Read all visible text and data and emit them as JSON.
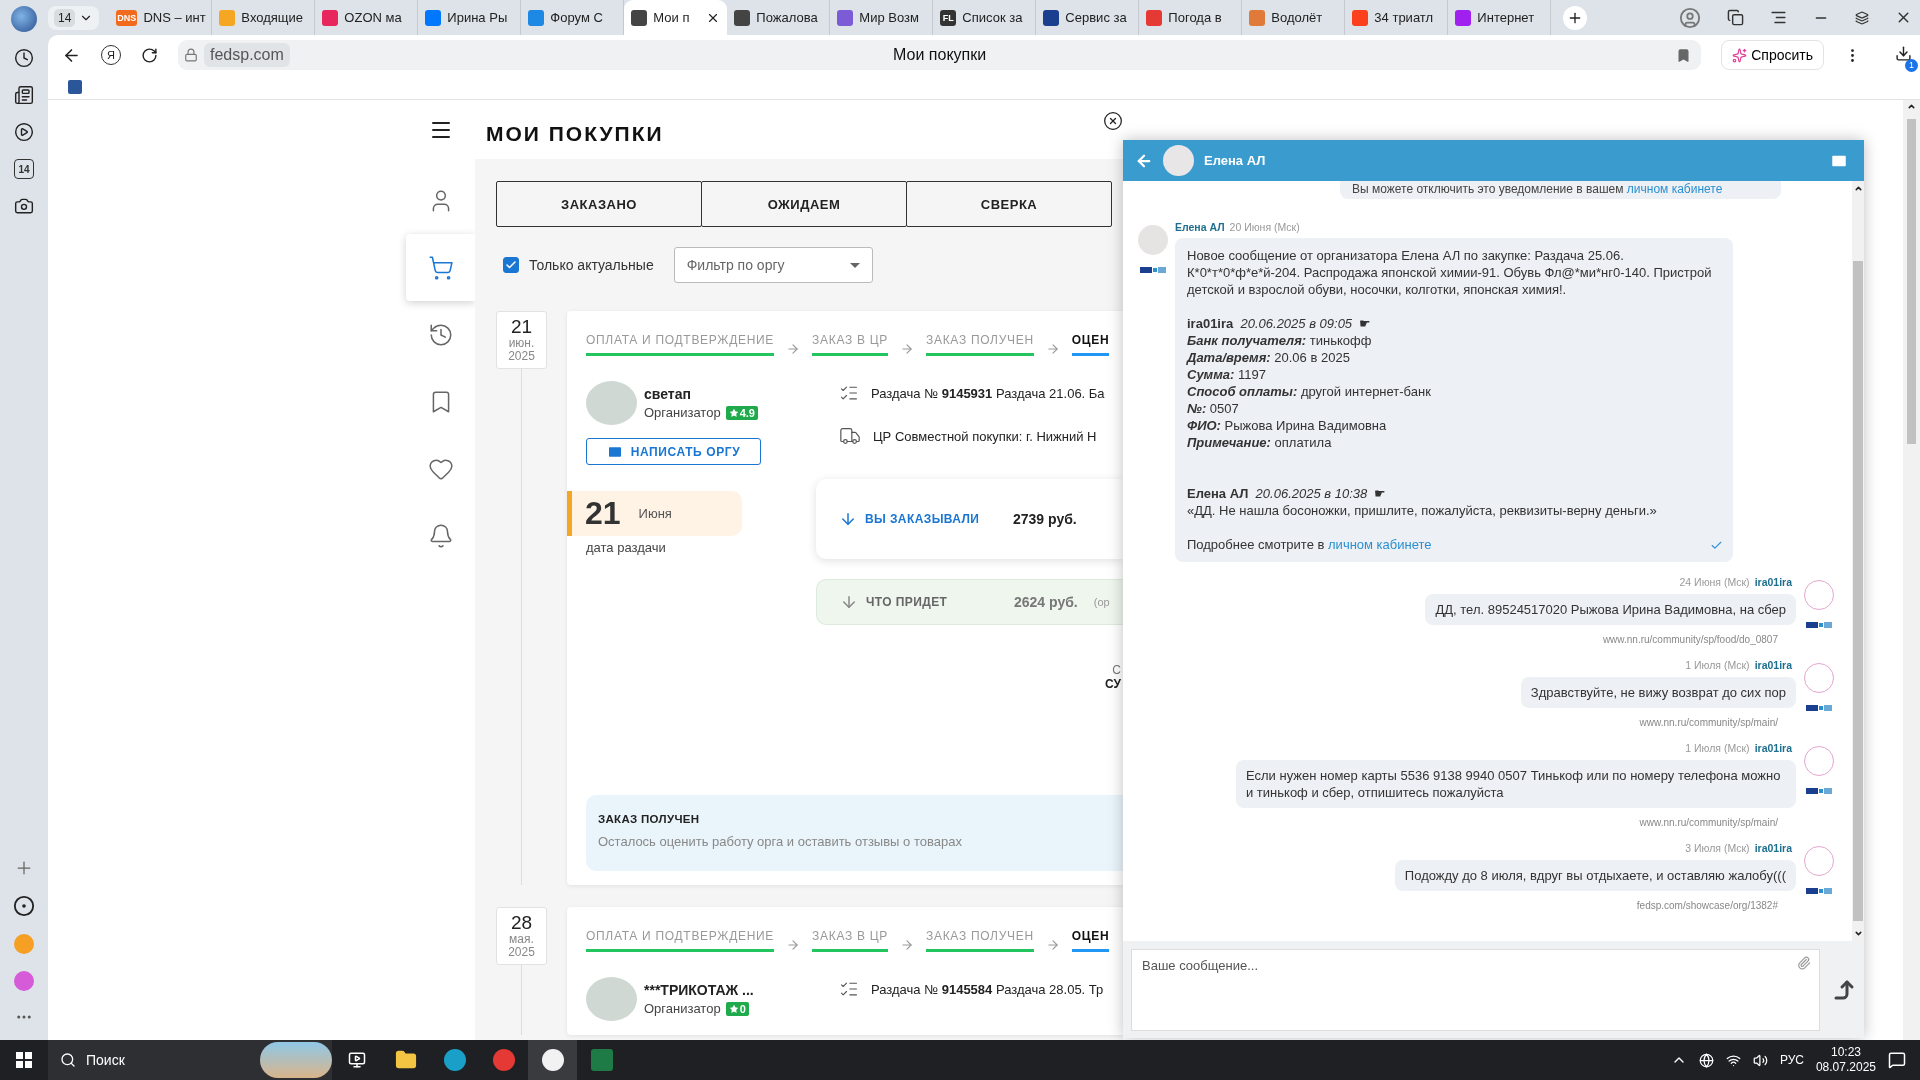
{
  "browser": {
    "tab_counter": "14",
    "tabs": [
      {
        "title": "DNS – инт",
        "color": "#f26a1b",
        "badge": "DNS",
        "selected": false
      },
      {
        "title": "Входящие",
        "color": "#f5a623",
        "selected": false
      },
      {
        "title": "OZON ма",
        "color": "#e8265e",
        "selected": false
      },
      {
        "title": "Ирина Ры",
        "color": "#0077ff",
        "selected": false
      },
      {
        "title": "Форум С",
        "color": "#1e88e5",
        "selected": false
      },
      {
        "title": "Мои п",
        "color": "#444444",
        "selected": true
      },
      {
        "title": "Пожалова",
        "color": "#444444",
        "selected": false
      },
      {
        "title": "Мир Возм",
        "color": "#7b5cd6",
        "selected": false
      },
      {
        "title": "Список за",
        "color": "#333333",
        "badge": "FL",
        "selected": false
      },
      {
        "title": "Сервис за",
        "color": "#1a3f8f",
        "selected": false
      },
      {
        "title": "Погода в",
        "color": "#e53935",
        "selected": false
      },
      {
        "title": "Водолёт",
        "color": "#e07a3a",
        "selected": false
      },
      {
        "title": "34 триатл",
        "color": "#fc3f1d",
        "selected": false
      },
      {
        "title": "Интернет",
        "color": "#a020f0",
        "selected": false
      }
    ],
    "search_engine_button": "Я",
    "url": "fedsp.com",
    "page_title": "Мои покупки",
    "ask_button": "Спросить",
    "downloads_badge": "1",
    "rail": {
      "top": [
        {
          "kind": "clock"
        },
        {
          "kind": "notes"
        },
        {
          "kind": "play"
        },
        {
          "kind": "calendar",
          "text": "14"
        },
        {
          "kind": "camera"
        }
      ],
      "bottom": [
        {
          "kind": "plus"
        },
        {
          "kind": "circle"
        },
        {
          "kind": "mail"
        },
        {
          "kind": "assistant"
        },
        {
          "kind": "more"
        }
      ]
    }
  },
  "site": {
    "title": "МОИ ПОКУПКИ",
    "nav": [
      {
        "kind": "user",
        "selected": false
      },
      {
        "kind": "cart",
        "selected": true
      },
      {
        "kind": "history",
        "selected": false
      },
      {
        "kind": "bookmark",
        "selected": false
      },
      {
        "kind": "heart",
        "selected": false
      },
      {
        "kind": "bell",
        "selected": false
      }
    ],
    "tabs": [
      {
        "label": "ЗАКАЗАНО",
        "selected": false
      },
      {
        "label": "ОЖИДАЕМ",
        "selected": false
      },
      {
        "label": "СВЕРКА",
        "selected": false
      }
    ],
    "only_actual": {
      "label": "Только актуальные",
      "checked": true
    },
    "org_filter": {
      "placeholder": "Фильтр по оргу"
    },
    "orders": [
      {
        "date": {
          "day": "21",
          "month": "июн.",
          "year": "2025"
        },
        "steps": [
          {
            "label": "ОПЛАТА И ПОДТВЕРЖДЕНИЕ",
            "current": false
          },
          {
            "label": "ЗАКАЗ В ЦР",
            "current": false
          },
          {
            "label": "ЗАКАЗ ПОЛУЧЕН",
            "current": false
          },
          {
            "label": "ОЦЕН",
            "current": true
          }
        ],
        "organizer": {
          "name": "светап",
          "role": "Организатор",
          "rating": "4.9"
        },
        "write_button": "НАПИСАТЬ ОРГУ",
        "lines": [
          {
            "kind": "list",
            "text": "Раздача № **9145931** Раздача 21.06. Ба"
          },
          {
            "kind": "truck",
            "text": "ЦР Совместной покупки: г. Нижний Н"
          }
        ],
        "handout": {
          "day": "21",
          "month": "Июня",
          "caption": "дата раздачи"
        },
        "ordered": {
          "label": "ВЫ ЗАКАЗЫВАЛИ",
          "amount": "2739 руб."
        },
        "arriving": {
          "label": "ЧТО ПРИДЕТ",
          "amount": "2624 руб.",
          "note": "(ор"
        },
        "cut_texts": [
          "С",
          "СУ"
        ],
        "status": {
          "title": "ЗАКАЗ ПОЛУЧЕН",
          "text": "Осталось оценить работу орга и оставить отзывы о товарах"
        }
      },
      {
        "date": {
          "day": "28",
          "month": "мая.",
          "year": "2025"
        },
        "steps": [
          {
            "label": "ОПЛАТА И ПОДТВЕРЖДЕНИЕ",
            "current": false
          },
          {
            "label": "ЗАКАЗ В ЦР",
            "current": false
          },
          {
            "label": "ЗАКАЗ ПОЛУЧЕН",
            "current": false
          },
          {
            "label": "ОЦЕН",
            "current": true
          }
        ],
        "organizer": {
          "name": "***ТРИКОТАЖ ...",
          "role": "Организатор",
          "rating": "0"
        },
        "lines": [
          {
            "kind": "list",
            "text": "Раздача № **9145584** Раздача 28.05. Тр"
          }
        ]
      }
    ]
  },
  "chat": {
    "title": "Елена АЛ",
    "top_notice": {
      "text": "Вы можете отключить это уведомление в вашем ",
      "link": "личном кабинете"
    },
    "messages": [
      {
        "kind": "incoming",
        "author": "Елена АЛ",
        "date": "20 Июня (Мск)",
        "read": true,
        "intro": "Новое сообщение от организатора Елена АЛ по закупке: Раздача 25.06. К*0*т*0*ф*е*й-204. Распродажа японской химии-91. Обувь Фл@*ми*нг0-140. Пристрой детской и взрослой обуви, носочки, колготки, японская химия!.",
        "payment": {
          "author": "ira01ira",
          "time": "20.06.2025 в 09:05",
          "mark": "☛",
          "fields": [
            {
              "label": "Банк получателя:",
              "value": "тинькофф"
            },
            {
              "label": "Дата/время:",
              "value": "20.06 в 2025"
            },
            {
              "label": "Сумма:",
              "value": "1197"
            },
            {
              "label": "Способ оплаты:",
              "value": "другой интернет-банк"
            },
            {
              "label": "№:",
              "value": "0507"
            },
            {
              "label": "ФИО:",
              "value": "Рыжова Ирина Вадимовна"
            },
            {
              "label": "Примечание:",
              "value": "оплатила"
            }
          ]
        },
        "reply": {
          "author": "Елена АЛ",
          "time": "20.06.2025 в 10:38",
          "mark": "☛",
          "text": "«ДД. Не нашла босоножки, пришлите, пожалуйста, реквизиты-верну деньги.»"
        },
        "footer": {
          "text": "Подробнее смотрите в ",
          "link": "личном кабинете"
        }
      },
      {
        "kind": "outgoing",
        "author": "ira01ira",
        "date": "24 Июня (Мск)",
        "read": false,
        "text": "ДД, тел. 89524517020 Рыжова Ирина Вадимовна, на сбер",
        "source": "www.nn.ru/community/sp/food/do_0807"
      },
      {
        "kind": "outgoing",
        "author": "ira01ira",
        "date": "1 Июля (Мск)",
        "read": false,
        "text": "Здравствуйте, не вижу возврат до сих пор",
        "source": "www.nn.ru/community/sp/main/"
      },
      {
        "kind": "outgoing",
        "author": "ira01ira",
        "date": "1 Июля (Мск)",
        "read": false,
        "text": "Если нужен номер карты 5536 9138 9940 0507 Тинькоф или по номеру телефона можно и тинькоф и сбер, отпишитесь пожалуйста",
        "source": "www.nn.ru/community/sp/main/"
      },
      {
        "kind": "outgoing",
        "author": "ira01ira",
        "date": "3 Июля (Мск)",
        "read": false,
        "text": "Подожду до 8 июля, вдруг вы отдыхаете, и оставляю жалобу(((",
        "source": "fedsp.com/showcase/org/1382#"
      }
    ],
    "input": {
      "placeholder": "Ваше сообщение..."
    }
  },
  "taskbar": {
    "search": "Поиск",
    "language": "РУС",
    "time": "10:23",
    "date": "08.07.2025"
  }
}
